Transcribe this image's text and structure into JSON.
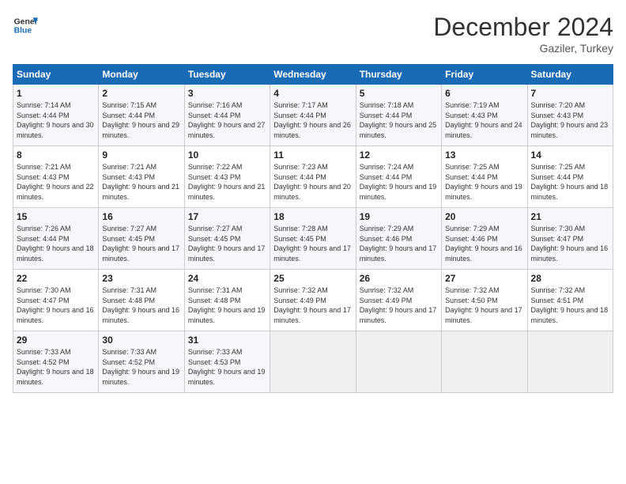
{
  "header": {
    "logo_line1": "General",
    "logo_line2": "Blue",
    "month_title": "December 2024",
    "subtitle": "Gaziler, Turkey"
  },
  "weekdays": [
    "Sunday",
    "Monday",
    "Tuesday",
    "Wednesday",
    "Thursday",
    "Friday",
    "Saturday"
  ],
  "weeks": [
    [
      {
        "day": "1",
        "sunrise": "7:14 AM",
        "sunset": "4:44 PM",
        "daylight": "9 hours and 30 minutes."
      },
      {
        "day": "2",
        "sunrise": "7:15 AM",
        "sunset": "4:44 PM",
        "daylight": "9 hours and 29 minutes."
      },
      {
        "day": "3",
        "sunrise": "7:16 AM",
        "sunset": "4:44 PM",
        "daylight": "9 hours and 27 minutes."
      },
      {
        "day": "4",
        "sunrise": "7:17 AM",
        "sunset": "4:44 PM",
        "daylight": "9 hours and 26 minutes."
      },
      {
        "day": "5",
        "sunrise": "7:18 AM",
        "sunset": "4:44 PM",
        "daylight": "9 hours and 25 minutes."
      },
      {
        "day": "6",
        "sunrise": "7:19 AM",
        "sunset": "4:43 PM",
        "daylight": "9 hours and 24 minutes."
      },
      {
        "day": "7",
        "sunrise": "7:20 AM",
        "sunset": "4:43 PM",
        "daylight": "9 hours and 23 minutes."
      }
    ],
    [
      {
        "day": "8",
        "sunrise": "7:21 AM",
        "sunset": "4:43 PM",
        "daylight": "9 hours and 22 minutes."
      },
      {
        "day": "9",
        "sunrise": "7:21 AM",
        "sunset": "4:43 PM",
        "daylight": "9 hours and 21 minutes."
      },
      {
        "day": "10",
        "sunrise": "7:22 AM",
        "sunset": "4:43 PM",
        "daylight": "9 hours and 21 minutes."
      },
      {
        "day": "11",
        "sunrise": "7:23 AM",
        "sunset": "4:44 PM",
        "daylight": "9 hours and 20 minutes."
      },
      {
        "day": "12",
        "sunrise": "7:24 AM",
        "sunset": "4:44 PM",
        "daylight": "9 hours and 19 minutes."
      },
      {
        "day": "13",
        "sunrise": "7:25 AM",
        "sunset": "4:44 PM",
        "daylight": "9 hours and 19 minutes."
      },
      {
        "day": "14",
        "sunrise": "7:25 AM",
        "sunset": "4:44 PM",
        "daylight": "9 hours and 18 minutes."
      }
    ],
    [
      {
        "day": "15",
        "sunrise": "7:26 AM",
        "sunset": "4:44 PM",
        "daylight": "9 hours and 18 minutes."
      },
      {
        "day": "16",
        "sunrise": "7:27 AM",
        "sunset": "4:45 PM",
        "daylight": "9 hours and 17 minutes."
      },
      {
        "day": "17",
        "sunrise": "7:27 AM",
        "sunset": "4:45 PM",
        "daylight": "9 hours and 17 minutes."
      },
      {
        "day": "18",
        "sunrise": "7:28 AM",
        "sunset": "4:45 PM",
        "daylight": "9 hours and 17 minutes."
      },
      {
        "day": "19",
        "sunrise": "7:29 AM",
        "sunset": "4:46 PM",
        "daylight": "9 hours and 17 minutes."
      },
      {
        "day": "20",
        "sunrise": "7:29 AM",
        "sunset": "4:46 PM",
        "daylight": "9 hours and 16 minutes."
      },
      {
        "day": "21",
        "sunrise": "7:30 AM",
        "sunset": "4:47 PM",
        "daylight": "9 hours and 16 minutes."
      }
    ],
    [
      {
        "day": "22",
        "sunrise": "7:30 AM",
        "sunset": "4:47 PM",
        "daylight": "9 hours and 16 minutes."
      },
      {
        "day": "23",
        "sunrise": "7:31 AM",
        "sunset": "4:48 PM",
        "daylight": "9 hours and 16 minutes."
      },
      {
        "day": "24",
        "sunrise": "7:31 AM",
        "sunset": "4:48 PM",
        "daylight": "9 hours and 19 minutes."
      },
      {
        "day": "25",
        "sunrise": "7:32 AM",
        "sunset": "4:49 PM",
        "daylight": "9 hours and 17 minutes."
      },
      {
        "day": "26",
        "sunrise": "7:32 AM",
        "sunset": "4:49 PM",
        "daylight": "9 hours and 17 minutes."
      },
      {
        "day": "27",
        "sunrise": "7:32 AM",
        "sunset": "4:50 PM",
        "daylight": "9 hours and 17 minutes."
      },
      {
        "day": "28",
        "sunrise": "7:32 AM",
        "sunset": "4:51 PM",
        "daylight": "9 hours and 18 minutes."
      }
    ],
    [
      {
        "day": "29",
        "sunrise": "7:33 AM",
        "sunset": "4:52 PM",
        "daylight": "9 hours and 18 minutes."
      },
      {
        "day": "30",
        "sunrise": "7:33 AM",
        "sunset": "4:52 PM",
        "daylight": "9 hours and 19 minutes."
      },
      {
        "day": "31",
        "sunrise": "7:33 AM",
        "sunset": "4:53 PM",
        "daylight": "9 hours and 19 minutes."
      },
      null,
      null,
      null,
      null
    ]
  ]
}
